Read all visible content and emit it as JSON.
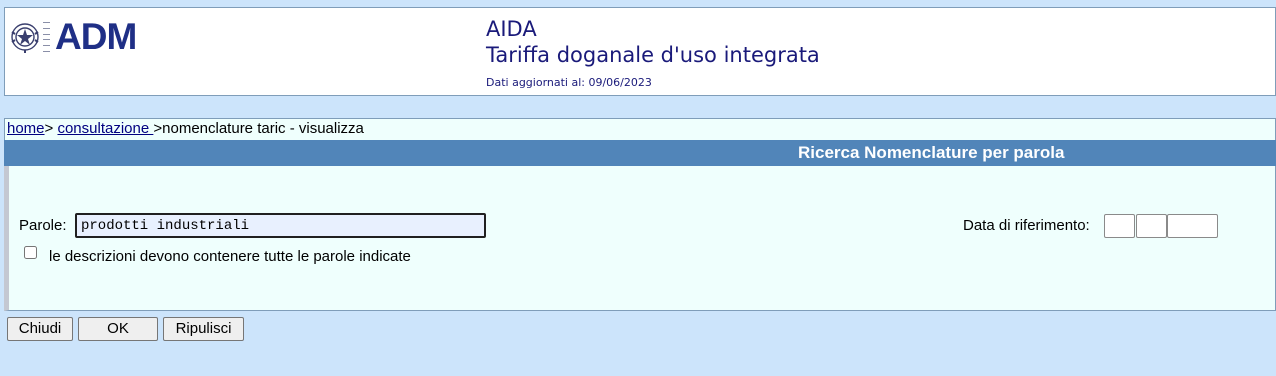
{
  "header": {
    "logo_text": "ADM",
    "app_title": "AIDA",
    "app_subtitle": "Tariffa doganale d'uso integrata",
    "updated_label": "Dati aggiornati al: 09/06/2023"
  },
  "breadcrumb": {
    "home": "home",
    "sep1": "> ",
    "consultazione": "consultazione ",
    "sep2": ">",
    "current": "nomenclature taric - visualizza"
  },
  "panel": {
    "title": "Ricerca Nomenclature per parola",
    "parole_label": "Parole:",
    "parole_value": "prodotti industriali",
    "all_words_label": "le descrizioni devono contenere tutte le parole indicate",
    "all_words_checked": false,
    "data_label": "Data di riferimento:"
  },
  "buttons": {
    "chiudi": "Chiudi",
    "ok": "OK",
    "ripulisci": "Ripulisci"
  },
  "colors": {
    "page_bg": "#cce4fb",
    "title_bar": "#5185b9",
    "panel_bg": "#effffd",
    "brand": "#1f2f86"
  }
}
